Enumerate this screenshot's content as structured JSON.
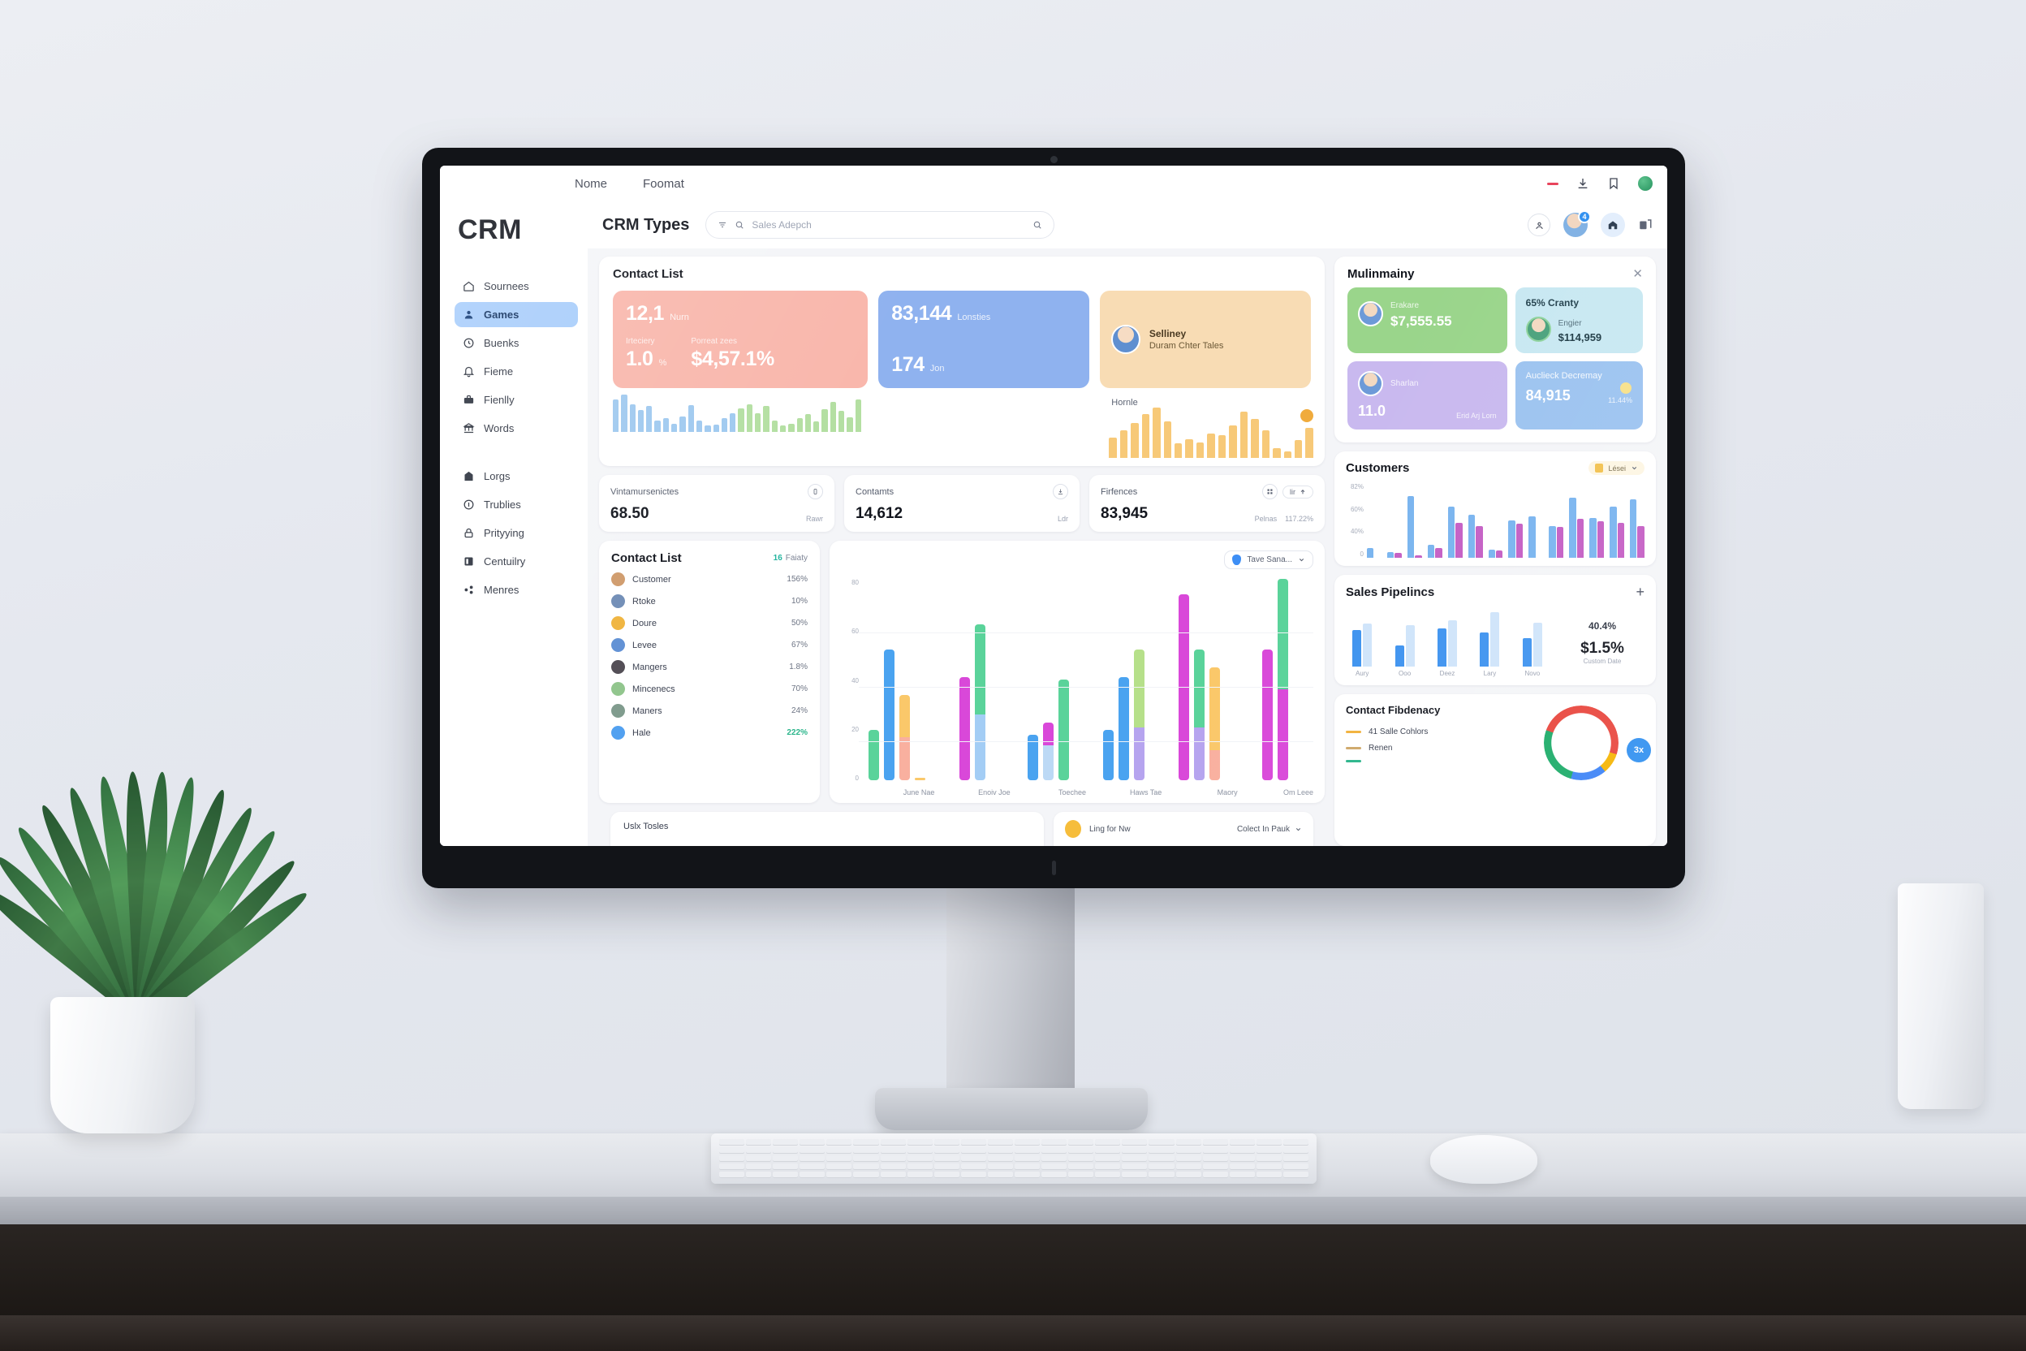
{
  "window": {
    "tabs": [
      "Nome",
      "Foomat"
    ],
    "controls": [
      "minimize-dash",
      "download-icon",
      "bookmark-icon",
      "account-avatar"
    ]
  },
  "sidebar": {
    "logo": "CRM",
    "group1": [
      {
        "label": "Sournees",
        "icon": "home-icon",
        "active": false
      },
      {
        "label": "Games",
        "icon": "user-icon",
        "active": true
      },
      {
        "label": "Buenks",
        "icon": "clock-icon",
        "active": false
      },
      {
        "label": "Fieme",
        "icon": "bell-icon",
        "active": false
      },
      {
        "label": "Fienlly",
        "icon": "briefcase-icon",
        "active": false
      },
      {
        "label": "Words",
        "icon": "bank-icon",
        "active": false
      }
    ],
    "group2": [
      {
        "label": "Lorgs",
        "icon": "building-icon",
        "active": false
      },
      {
        "label": "Trublies",
        "icon": "info-icon",
        "active": false
      },
      {
        "label": "Prityying",
        "icon": "lock-icon",
        "active": false
      },
      {
        "label": "Centuilry",
        "icon": "book-icon",
        "active": false
      },
      {
        "label": "Menres",
        "icon": "share-icon",
        "active": false
      }
    ]
  },
  "topbar": {
    "title": "CRM Types",
    "search_placeholder": "Sales Adepch",
    "search_value": "",
    "badge_count": "4"
  },
  "contact_panel": {
    "title": "Contact List",
    "kpi_pink": {
      "value": "12,1",
      "unit": "Nurn",
      "metric_value": "1.0",
      "metric_unit": "%",
      "metric_label": "Irteciery",
      "secondary_label": "Porreat zees",
      "secondary_value": "$4,57.1%"
    },
    "kpi_blue": {
      "value": "83,144",
      "unit": "Lonsties",
      "second_value": "174",
      "second_unit": "Jon"
    },
    "kpi_peach": {
      "name": "Selliney",
      "desc": "Duram Chter Tales",
      "chart_label": "Hornle"
    }
  },
  "stats": [
    {
      "label": "Vintamursenictes",
      "value": "68.50",
      "note": "Rawr",
      "icon": "battery-icon"
    },
    {
      "label": "Contamts",
      "value": "14,612",
      "note": "Ldr",
      "icon": "download-icon"
    },
    {
      "label": "Firfences",
      "value": "83,945",
      "note": "Pelnas",
      "icon": "grid-icon",
      "pill_label": "lir",
      "pill_value": "117.22%"
    }
  ],
  "contact_list": {
    "title": "Contact List",
    "badge_value": "16",
    "badge_label": "Faiaty",
    "rows": [
      {
        "name": "Customer",
        "value": "156%",
        "color": "#cf9a6a"
      },
      {
        "name": "Rtoke",
        "value": "10%",
        "color": "#6f8cb5"
      },
      {
        "name": "Doure",
        "value": "50%",
        "color": "#f0b33c"
      },
      {
        "name": "Levee",
        "value": "67%",
        "color": "#5e8fd4"
      },
      {
        "name": "Mangers",
        "value": "1.8%",
        "color": "#4f4a52"
      },
      {
        "name": "Mincenecs",
        "value": "70%",
        "color": "#8fc58b"
      },
      {
        "name": "Maners",
        "value": "24%",
        "color": "#7e9a8c"
      },
      {
        "name": "Hale",
        "value": "222%",
        "color": "#4f9ff0",
        "highlight": true
      }
    ]
  },
  "main_chart": {
    "selector_label": "Tave Sana...",
    "chart_data": {
      "type": "bar",
      "title": "",
      "xlabel": "",
      "ylabel": "",
      "ylim": [
        0,
        80
      ],
      "yticks": [
        "80",
        "60",
        "40",
        "20",
        "0"
      ],
      "grid": true,
      "categories": [
        "June Nae",
        "Enoiv Joe",
        "Toechee",
        "Haws Tae",
        "Maory",
        "Om Leee"
      ],
      "groups": [
        {
          "category": "June Nae",
          "bars": [
            {
              "segments": [
                {
                  "value": 20,
                  "color": "#5ad39a"
                }
              ]
            },
            {
              "segments": [
                {
                  "value": 52,
                  "color": "#4aa3f0"
                }
              ]
            },
            {
              "segments": [
                {
                  "value": 17,
                  "color": "#f9b09f"
                },
                {
                  "value": 17,
                  "color": "#fac86a"
                }
              ]
            },
            {
              "segments": [
                {
                  "value": 1,
                  "color": "#fac86a"
                }
              ]
            }
          ]
        },
        {
          "category": "Enoiv Joe",
          "bars": [
            {
              "segments": [
                {
                  "value": 41,
                  "color": "#d948d9"
                }
              ]
            },
            {
              "segments": [
                {
                  "value": 26,
                  "color": "#a3cdf5"
                },
                {
                  "value": 36,
                  "color": "#5ad39a"
                }
              ]
            }
          ]
        },
        {
          "category": "Toechee",
          "bars": [
            {
              "segments": [
                {
                  "value": 18,
                  "color": "#4aa3f0"
                }
              ]
            },
            {
              "segments": [
                {
                  "value": 14,
                  "color": "#bcd9f5"
                },
                {
                  "value": 9,
                  "color": "#d948d9"
                }
              ]
            },
            {
              "segments": [
                {
                  "value": 40,
                  "color": "#5ad39a"
                }
              ]
            }
          ]
        },
        {
          "category": "Haws Tae",
          "bars": [
            {
              "segments": [
                {
                  "value": 20,
                  "color": "#4aa3f0"
                }
              ]
            },
            {
              "segments": [
                {
                  "value": 41,
                  "color": "#4aa3f0"
                }
              ]
            },
            {
              "segments": [
                {
                  "value": 21,
                  "color": "#b6a4ef"
                },
                {
                  "value": 31,
                  "color": "#b6e08a"
                }
              ]
            }
          ]
        },
        {
          "category": "Maory",
          "bars": [
            {
              "segments": [
                {
                  "value": 74,
                  "color": "#d948d9"
                }
              ]
            },
            {
              "segments": [
                {
                  "value": 21,
                  "color": "#b6a4ef"
                },
                {
                  "value": 31,
                  "color": "#5ad39a"
                }
              ]
            },
            {
              "segments": [
                {
                  "value": 12,
                  "color": "#f9b09f"
                },
                {
                  "value": 33,
                  "color": "#fac86a"
                }
              ]
            }
          ]
        },
        {
          "category": "Om Leee",
          "bars": [
            {
              "segments": [
                {
                  "value": 52,
                  "color": "#d948d9"
                }
              ]
            },
            {
              "segments": [
                {
                  "value": 36,
                  "color": "#d948d9"
                },
                {
                  "value": 44,
                  "color": "#5ad39a"
                }
              ]
            }
          ]
        }
      ]
    }
  },
  "right_panel": {
    "title": "Mulinmainy",
    "close_label": "✕",
    "cards": {
      "green": {
        "label": "Erakare",
        "value": "$7,555.55"
      },
      "cyan": {
        "heading": "65% Cranty",
        "label": "Engier",
        "value": "$114,959"
      },
      "purple": {
        "label": "Sharlan",
        "value": "11.0",
        "side": "Erid Arj Lorn"
      },
      "blue": {
        "label": "Auclieck Decremay",
        "value": "84,915",
        "side": "11.44%"
      }
    }
  },
  "customers": {
    "title": "Customers",
    "selector_label": "Lései",
    "chart_data": {
      "type": "bar",
      "title": "Customers",
      "ylabel": "",
      "ylim": [
        0,
        90
      ],
      "yticks": [
        "82%",
        "60%",
        "40%",
        "0"
      ],
      "categories": [
        "1",
        "2",
        "3",
        "4",
        "5",
        "6",
        "7",
        "8",
        "9",
        "10",
        "11",
        "12",
        "13",
        "14"
      ],
      "series": [
        {
          "name": "blue",
          "color": "#79b4ef",
          "values": [
            12,
            7,
            74,
            16,
            62,
            52,
            10,
            45,
            50,
            38,
            72,
            48,
            62,
            70
          ]
        },
        {
          "name": "magenta",
          "color": "#c45ec4",
          "values": [
            0,
            6,
            3,
            12,
            42,
            38,
            9,
            41,
            0,
            37,
            47,
            44,
            42,
            38
          ]
        }
      ]
    }
  },
  "sales_pipelines": {
    "title": "Sales Pipelincs",
    "add_label": "+",
    "percent": "40.4%",
    "amount": "$1.5%",
    "caption": "Custom Date",
    "chart_data": {
      "type": "bar",
      "categories": [
        "Aury",
        "Ooo",
        "Deez",
        "Lary",
        "Novo"
      ],
      "series": [
        {
          "name": "dark",
          "color": "#3e93ef",
          "values": [
            62,
            36,
            64,
            58,
            48
          ]
        },
        {
          "name": "light",
          "color": "#cfe4fa",
          "values": [
            72,
            70,
            78,
            92,
            74
          ]
        }
      ]
    }
  },
  "contact_frequency": {
    "title": "Contact Fibdenacy",
    "badge": "3x",
    "legend": [
      {
        "label": "41 Salle Cohlors",
        "color": "#f2b23c"
      },
      {
        "label": "Renen",
        "color": "#cfa86a"
      },
      {
        "label": "",
        "color": "#2bb58b"
      }
    ],
    "chart_data": {
      "type": "pie",
      "title": "Contact Fibdenacy",
      "labels": [
        "red",
        "yellow",
        "blue",
        "green",
        "red2"
      ],
      "values": [
        30,
        9,
        16,
        26,
        19
      ],
      "colors": [
        "#e8453c",
        "#f5b400",
        "#3b82f6",
        "#1bab68",
        "#e8453c"
      ]
    }
  },
  "sparkline": {
    "chart_data": {
      "type": "bar",
      "categories": [
        "1",
        "2",
        "3",
        "4",
        "5",
        "6",
        "7",
        "8",
        "9",
        "10",
        "11",
        "12",
        "13",
        "14",
        "15",
        "16",
        "17",
        "18",
        "19",
        "20",
        "21",
        "22",
        "23",
        "24",
        "25",
        "26",
        "27",
        "28",
        "29",
        "30"
      ],
      "values": [
        62,
        72,
        54,
        42,
        50,
        22,
        26,
        16,
        30,
        52,
        22,
        12,
        14,
        26,
        36,
        46,
        54,
        36,
        50,
        22,
        12,
        16,
        26,
        34,
        20,
        44,
        58,
        40,
        28,
        62
      ],
      "colors_split": {
        "blue": "#9fc9ef",
        "green": "#b4dfa2",
        "split_index": 15
      }
    }
  },
  "peach_chart": {
    "chart_data": {
      "type": "bar",
      "values": [
        38,
        52,
        66,
        84,
        96,
        70,
        28,
        36,
        30,
        46,
        44,
        62,
        88,
        74,
        52,
        18,
        12,
        34,
        58
      ],
      "color": "#f7c978"
    }
  },
  "bottom_strip": {
    "left_label": "Uslx Tosles",
    "right_label": "Ling for Nw",
    "right_select": "Colect In Pauk"
  }
}
